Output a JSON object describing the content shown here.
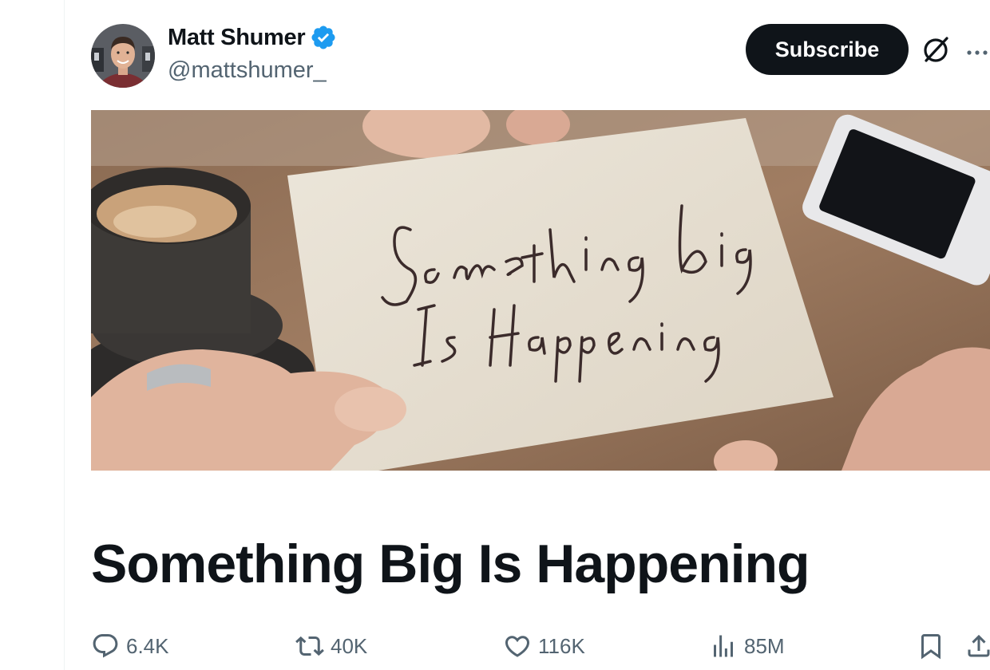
{
  "author": {
    "display_name": "Matt Shumer",
    "handle": "@mattshumer_",
    "verified": true,
    "avatar_icon": "profile-photo"
  },
  "header": {
    "subscribe_label": "Subscribe",
    "grok_icon": "grok-icon",
    "more_icon": "more-dots-icon"
  },
  "hero_image": {
    "handwritten_text": "Something Big Is Happening"
  },
  "article": {
    "title": "Something Big Is Happening"
  },
  "actions": {
    "replies": "6.4K",
    "reposts": "40K",
    "likes": "116K",
    "views": "85M"
  },
  "colors": {
    "text_primary": "#0f1419",
    "text_secondary": "#536471",
    "verified_blue": "#1d9bf0",
    "button_bg": "#0f1419"
  }
}
